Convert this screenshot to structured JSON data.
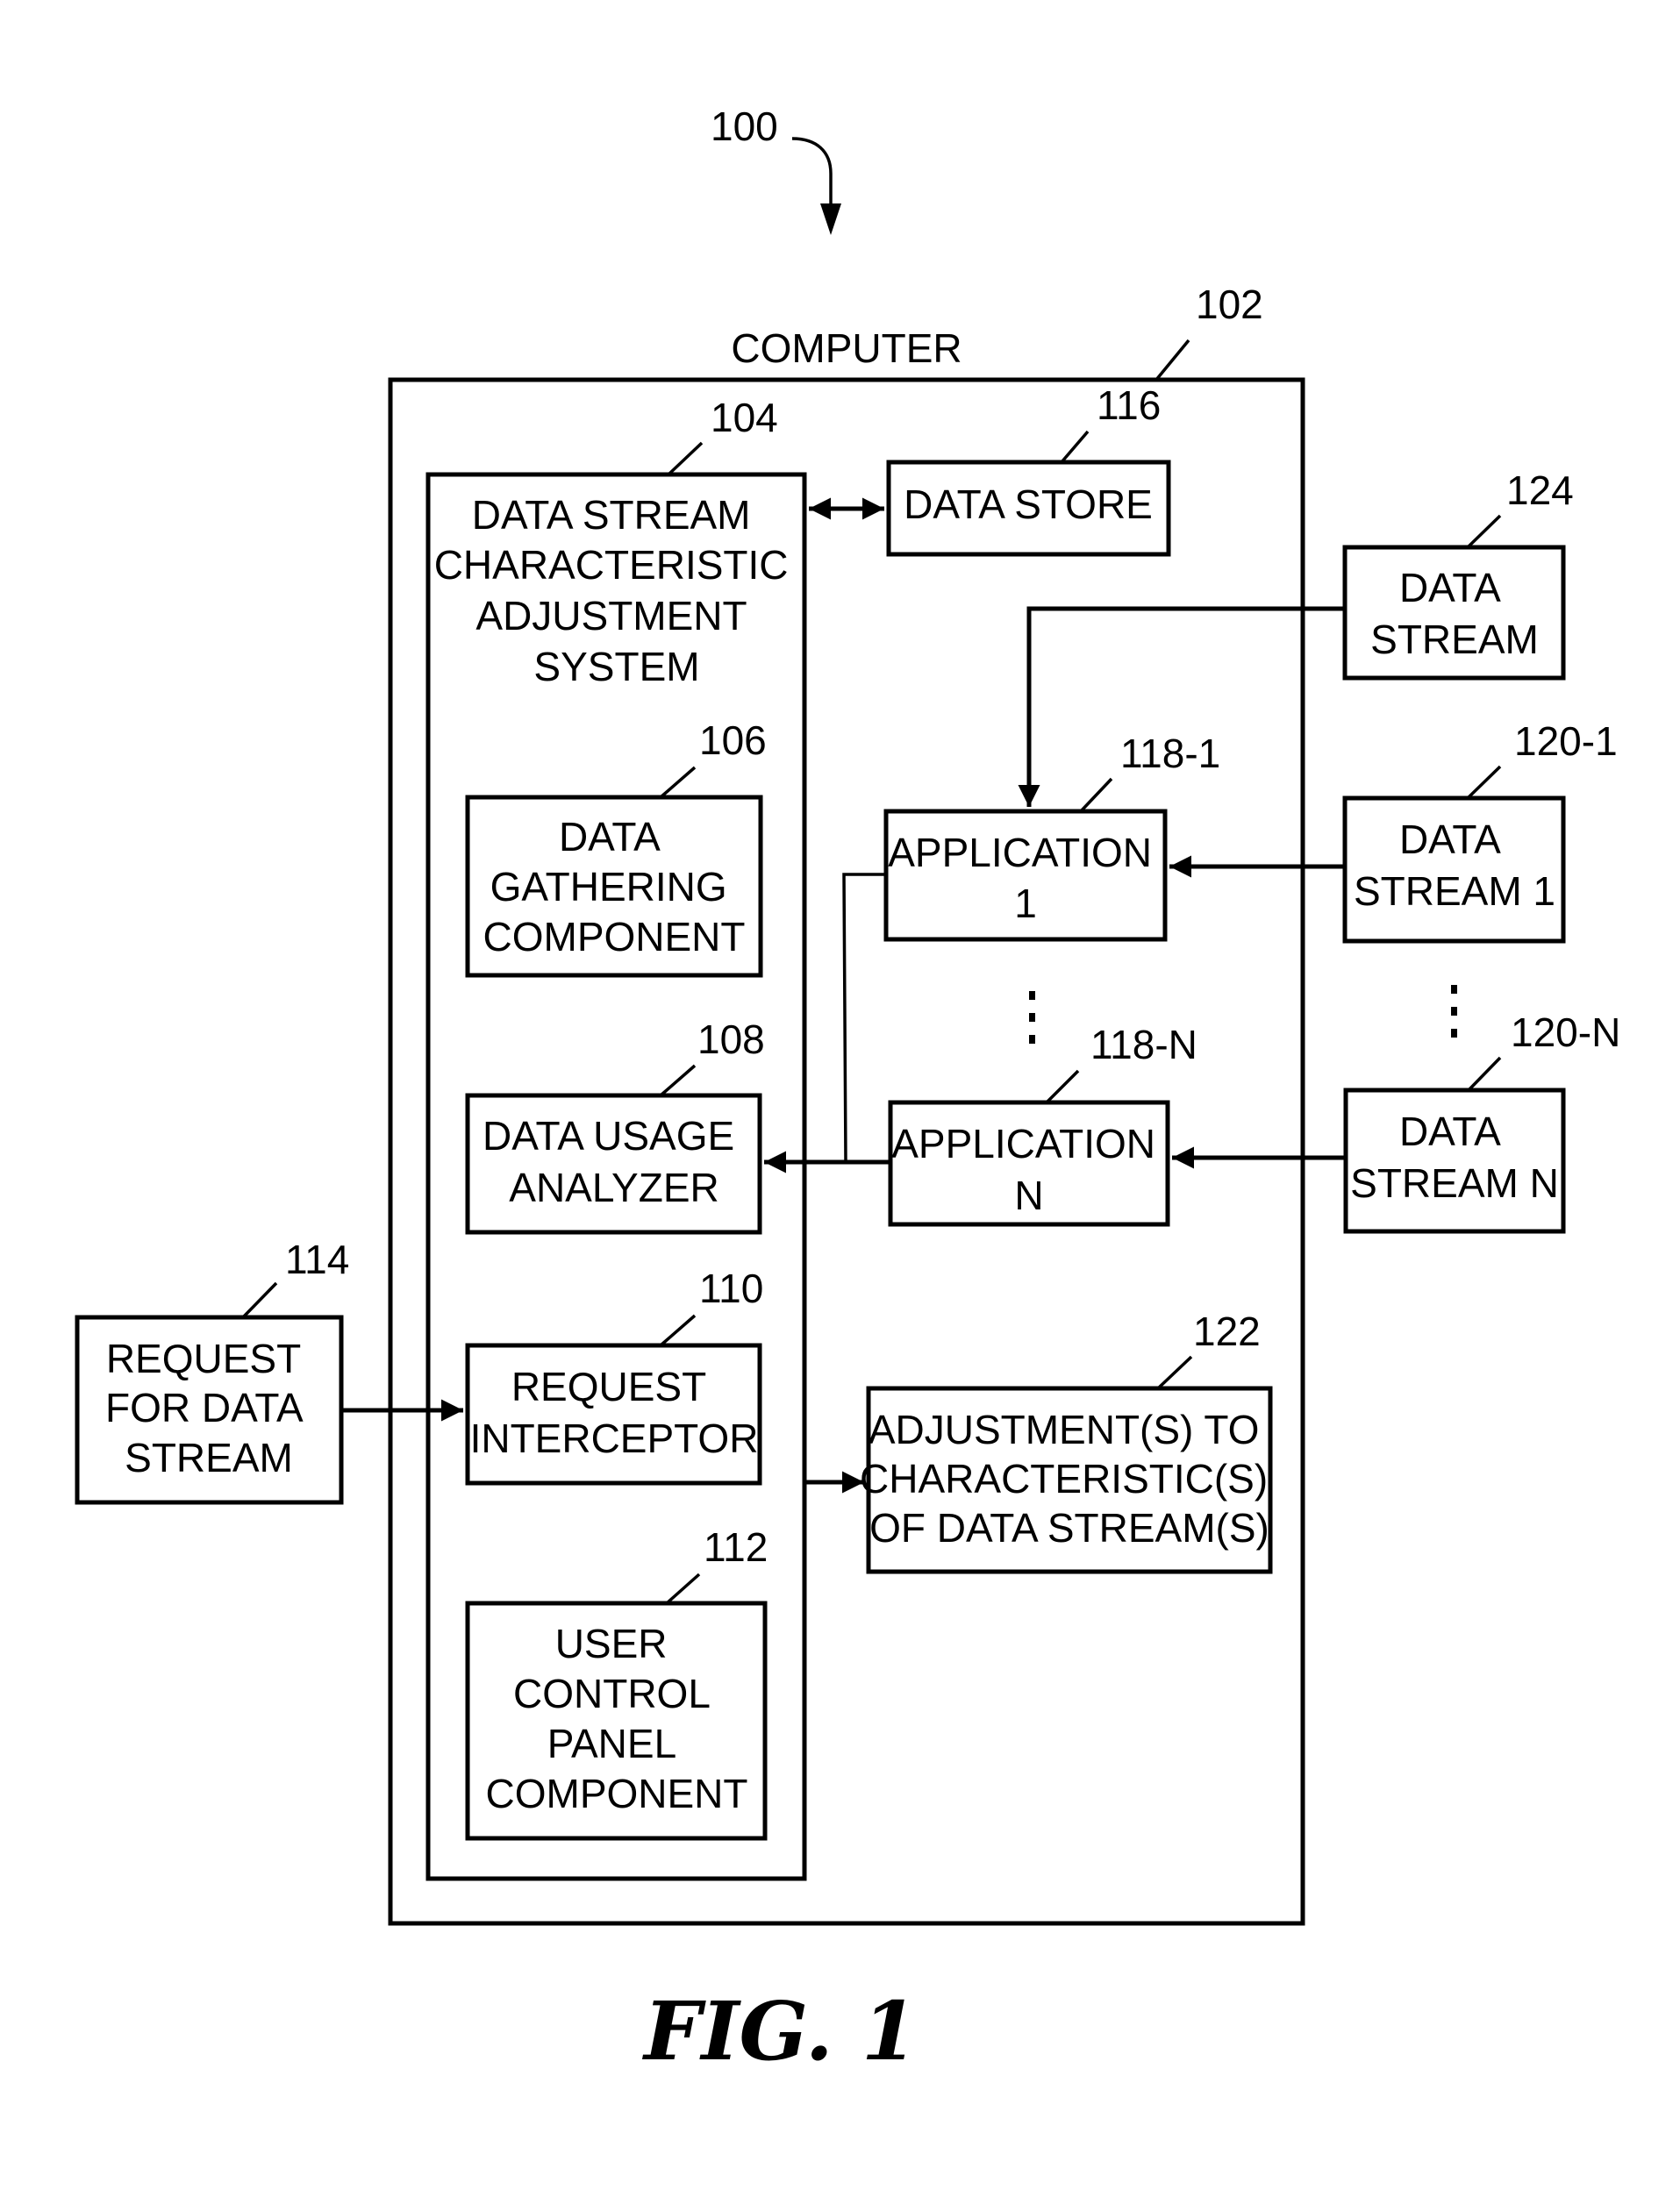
{
  "figure": {
    "caption": "FIG. 1",
    "system_ref": "100"
  },
  "computer": {
    "ref": "102",
    "label": "COMPUTER"
  },
  "components": {
    "adjustment_system": {
      "ref": "104",
      "lines": [
        "DATA STREAM",
        "CHARACTERISTIC",
        "ADJUSTMENT",
        "SYSTEM"
      ]
    },
    "data_gathering": {
      "ref": "106",
      "lines": [
        "DATA",
        "GATHERING",
        "COMPONENT"
      ]
    },
    "data_usage_analyzer": {
      "ref": "108",
      "lines": [
        "DATA USAGE",
        "ANALYZER"
      ]
    },
    "request_interceptor": {
      "ref": "110",
      "lines": [
        "REQUEST",
        "INTERCEPTOR"
      ]
    },
    "user_control_panel": {
      "ref": "112",
      "lines": [
        "USER",
        "CONTROL",
        "PANEL",
        "COMPONENT"
      ]
    },
    "request": {
      "ref": "114",
      "lines": [
        "REQUEST",
        "FOR DATA",
        "STREAM"
      ]
    },
    "data_store": {
      "ref": "116",
      "lines": [
        "DATA STORE"
      ]
    },
    "application_1": {
      "ref": "118-1",
      "lines": [
        "APPLICATION",
        "1"
      ]
    },
    "application_n": {
      "ref": "118-N",
      "lines": [
        "APPLICATION",
        "N"
      ]
    },
    "data_stream_1": {
      "ref": "120-1",
      "lines": [
        "DATA",
        "STREAM 1"
      ]
    },
    "data_stream_n": {
      "ref": "120-N",
      "lines": [
        "DATA",
        "STREAM N"
      ]
    },
    "adjustments": {
      "ref": "122",
      "lines": [
        "ADJUSTMENT(S) TO",
        "CHARACTERISTIC(S)",
        "OF DATA STREAM(S)"
      ]
    },
    "data_stream": {
      "ref": "124",
      "lines": [
        "DATA",
        "STREAM"
      ]
    }
  },
  "connections": [
    {
      "from": "adjustment_system",
      "to": "data_store",
      "type": "bidirectional-arrow"
    },
    {
      "from": "data_stream",
      "to": "application_1",
      "type": "arrow"
    },
    {
      "from": "data_stream_1",
      "to": "application_1",
      "type": "arrow"
    },
    {
      "from": "data_stream_n",
      "to": "application_n",
      "type": "arrow"
    },
    {
      "from": "application_1",
      "to": "data_usage_analyzer",
      "type": "arrow"
    },
    {
      "from": "application_n",
      "to": "data_usage_analyzer",
      "type": "arrow"
    },
    {
      "from": "request",
      "to": "request_interceptor",
      "type": "arrow"
    },
    {
      "from": "adjustment_system",
      "to": "adjustments",
      "type": "arrow"
    }
  ],
  "ellipsis_glyph": "⋮"
}
